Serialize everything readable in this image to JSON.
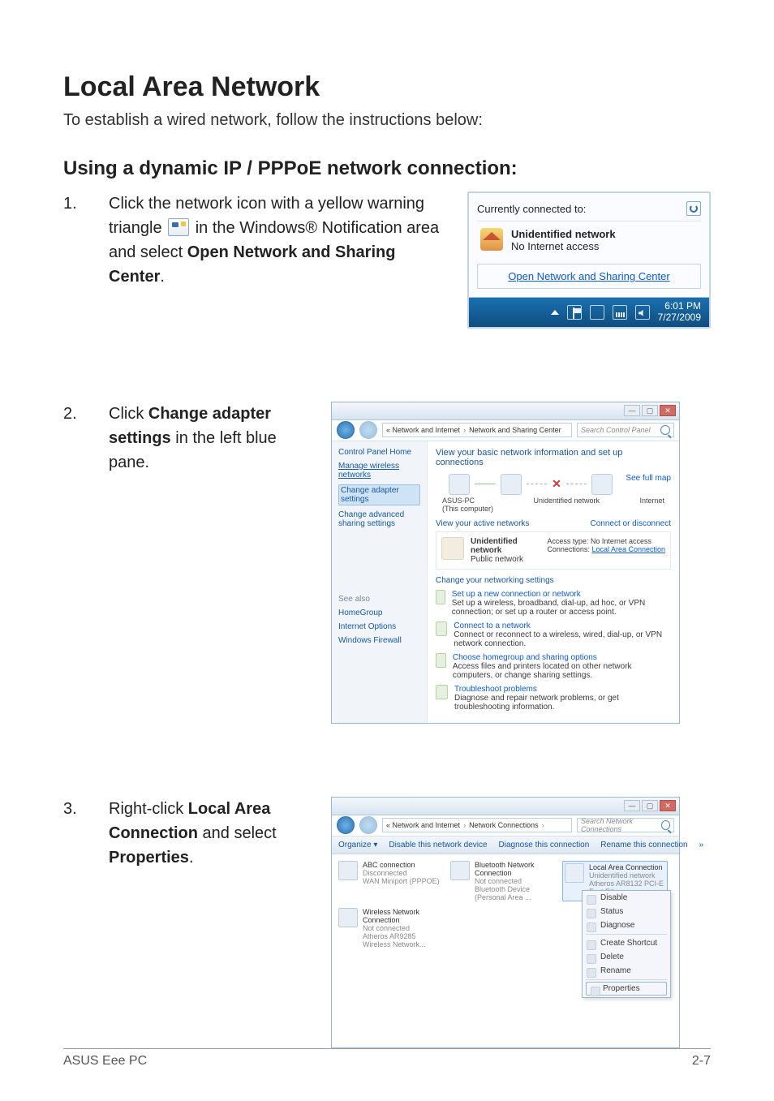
{
  "page": {
    "title": "Local Area Network",
    "intro": "To establish a wired network, follow the instructions below:",
    "subheading": "Using a dynamic IP / PPPoE network connection:"
  },
  "steps": {
    "s1": {
      "num": "1.",
      "text_a": "Click the network icon with a yellow warning triangle ",
      "text_b": " in the Windows® Notification area and select ",
      "bold": "Open Network and Sharing Center",
      "period": "."
    },
    "s2": {
      "num": "2.",
      "text_a": "Click ",
      "bold": "Change adapter settings",
      "text_b": " in the left blue pane."
    },
    "s3": {
      "num": "3.",
      "text_a": "Right-click ",
      "bold1": "Local Area Connection",
      "text_b": " and select ",
      "bold2": "Properties",
      "period": "."
    }
  },
  "shot1": {
    "header": "Currently connected to:",
    "net_title": "Unidentified network",
    "net_sub": "No Internet access",
    "link": "Open Network and Sharing Center",
    "time": "6:01 PM",
    "date": "7/27/2009"
  },
  "shot2": {
    "crumb1": "« Network and Internet",
    "crumb2": "Network and Sharing Center",
    "search_ph": "Search Control Panel",
    "left": {
      "l0": "Control Panel Home",
      "l1": "Manage wireless networks",
      "l2": "Change adapter settings",
      "l3": "Change advanced sharing settings",
      "see": "See also",
      "sa1": "HomeGroup",
      "sa2": "Internet Options",
      "sa3": "Windows Firewall"
    },
    "heading": "View your basic network information and set up connections",
    "full_map": "See full map",
    "node_a": "ASUS-PC",
    "node_a_sub": "(This computer)",
    "node_b": "Unidentified network",
    "node_c": "Internet",
    "active_hdr": "View your active networks",
    "conn_discon": "Connect or disconnect",
    "card_title": "Unidentified network",
    "card_sub": "Public network",
    "card_r1a": "Access type:",
    "card_r1b": "No Internet access",
    "card_r2a": "Connections:",
    "card_r2b": "Local Area Connection",
    "chg_hdr": "Change your networking settings",
    "t1": "Set up a new connection or network",
    "t1d": "Set up a wireless, broadband, dial-up, ad hoc, or VPN connection; or set up a router or access point.",
    "t2": "Connect to a network",
    "t2d": "Connect or reconnect to a wireless, wired, dial-up, or VPN network connection.",
    "t3": "Choose homegroup and sharing options",
    "t3d": "Access files and printers located on other network computers, or change sharing settings.",
    "t4": "Troubleshoot problems",
    "t4d": "Diagnose and repair network problems, or get troubleshooting information."
  },
  "shot3": {
    "crumb1": "« Network and Internet",
    "crumb2": "Network Connections",
    "search_ph": "Search Network Connections",
    "bar": {
      "b1": "Organize ▾",
      "b2": "Disable this network device",
      "b3": "Diagnose this connection",
      "b4": "Rename this connection",
      "b5": "»"
    },
    "c1t": "ABC connection",
    "c1s1": "Disconnected",
    "c1s2": "WAN Miniport (PPPOE)",
    "c2t": "Bluetooth Network Connection",
    "c2s1": "Not connected",
    "c2s2": "Bluetooth Device (Personal Area ...",
    "c3t": "Local Area Connection",
    "c3s1": "Unidentified network",
    "c3s2": "Atheros AR8132 PCI-E Fast Ethern...",
    "c4t": "Wireless Network Connection",
    "c4s1": "Not connected",
    "c4s2": "Atheros AR9285 Wireless Network...",
    "menu": {
      "m1": "Disable",
      "m2": "Status",
      "m3": "Diagnose",
      "m4": "Create Shortcut",
      "m5": "Delete",
      "m6": "Rename",
      "m7": "Properties"
    }
  },
  "footer": {
    "left": "ASUS Eee PC",
    "right": "2-7"
  }
}
